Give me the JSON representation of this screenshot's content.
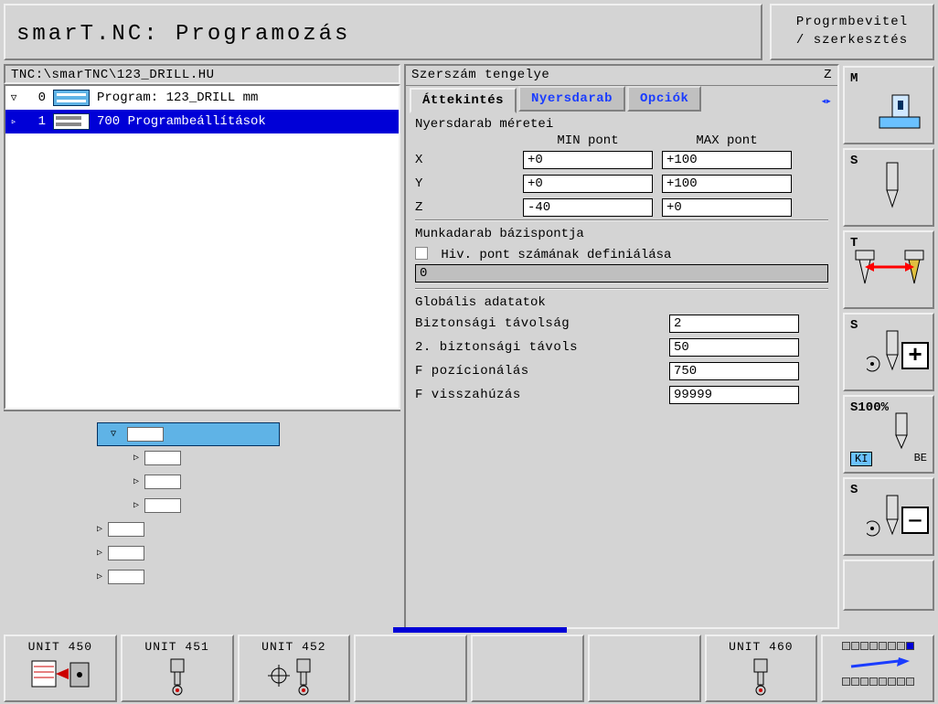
{
  "header": {
    "title": "smarT.NC: Programozás",
    "mode_line1": "Progrmbevitel",
    "mode_line2": "/ szerkesztés"
  },
  "path": "TNC:\\smarTNC\\123_DRILL.HU",
  "tree": {
    "row0": {
      "expander": "▽",
      "num": "0",
      "text": "Program: 123_DRILL mm"
    },
    "row1": {
      "expander": "▹",
      "num": "1",
      "text": "700 Programbeállítások"
    }
  },
  "detail": {
    "header_label": "Szerszám tengelye",
    "header_axis": "Z",
    "tabs": {
      "t0": "Áttekintés",
      "t1": "Nyersdarab",
      "t2": "Opciók",
      "nav": "◂▸"
    },
    "blank": {
      "title": "Nyersdarab méretei",
      "min_label": "MIN pont",
      "max_label": "MAX pont",
      "x_label": "X",
      "x_min": "+0",
      "x_max": "+100",
      "y_label": "Y",
      "y_min": "+0",
      "y_max": "+100",
      "z_label": "Z",
      "z_min": "-40",
      "z_max": "+0"
    },
    "datum": {
      "title": "Munkadarab bázispontja",
      "checkbox_label": "Hiv. pont számának definiálása",
      "value": "0"
    },
    "global": {
      "title": "Globális adatatok",
      "row0_label": "Biztonsági távolság",
      "row0_val": "2",
      "row1_label": "2. biztonsági távols",
      "row1_val": "50",
      "row2_label": "F pozícionálás",
      "row2_val": "750",
      "row3_label": "F visszahúzás",
      "row3_val": "99999"
    }
  },
  "sidebar": {
    "m": "M",
    "s": "S",
    "t": "T",
    "s2": "S",
    "s100": "S100%",
    "ki": "KI",
    "be": "BE",
    "s3": "S",
    "plus": "+",
    "minus": "—"
  },
  "softkeys": {
    "sk0": "UNIT 450",
    "sk1": "UNIT 451",
    "sk2": "UNIT 452",
    "sk6": "UNIT 460"
  }
}
